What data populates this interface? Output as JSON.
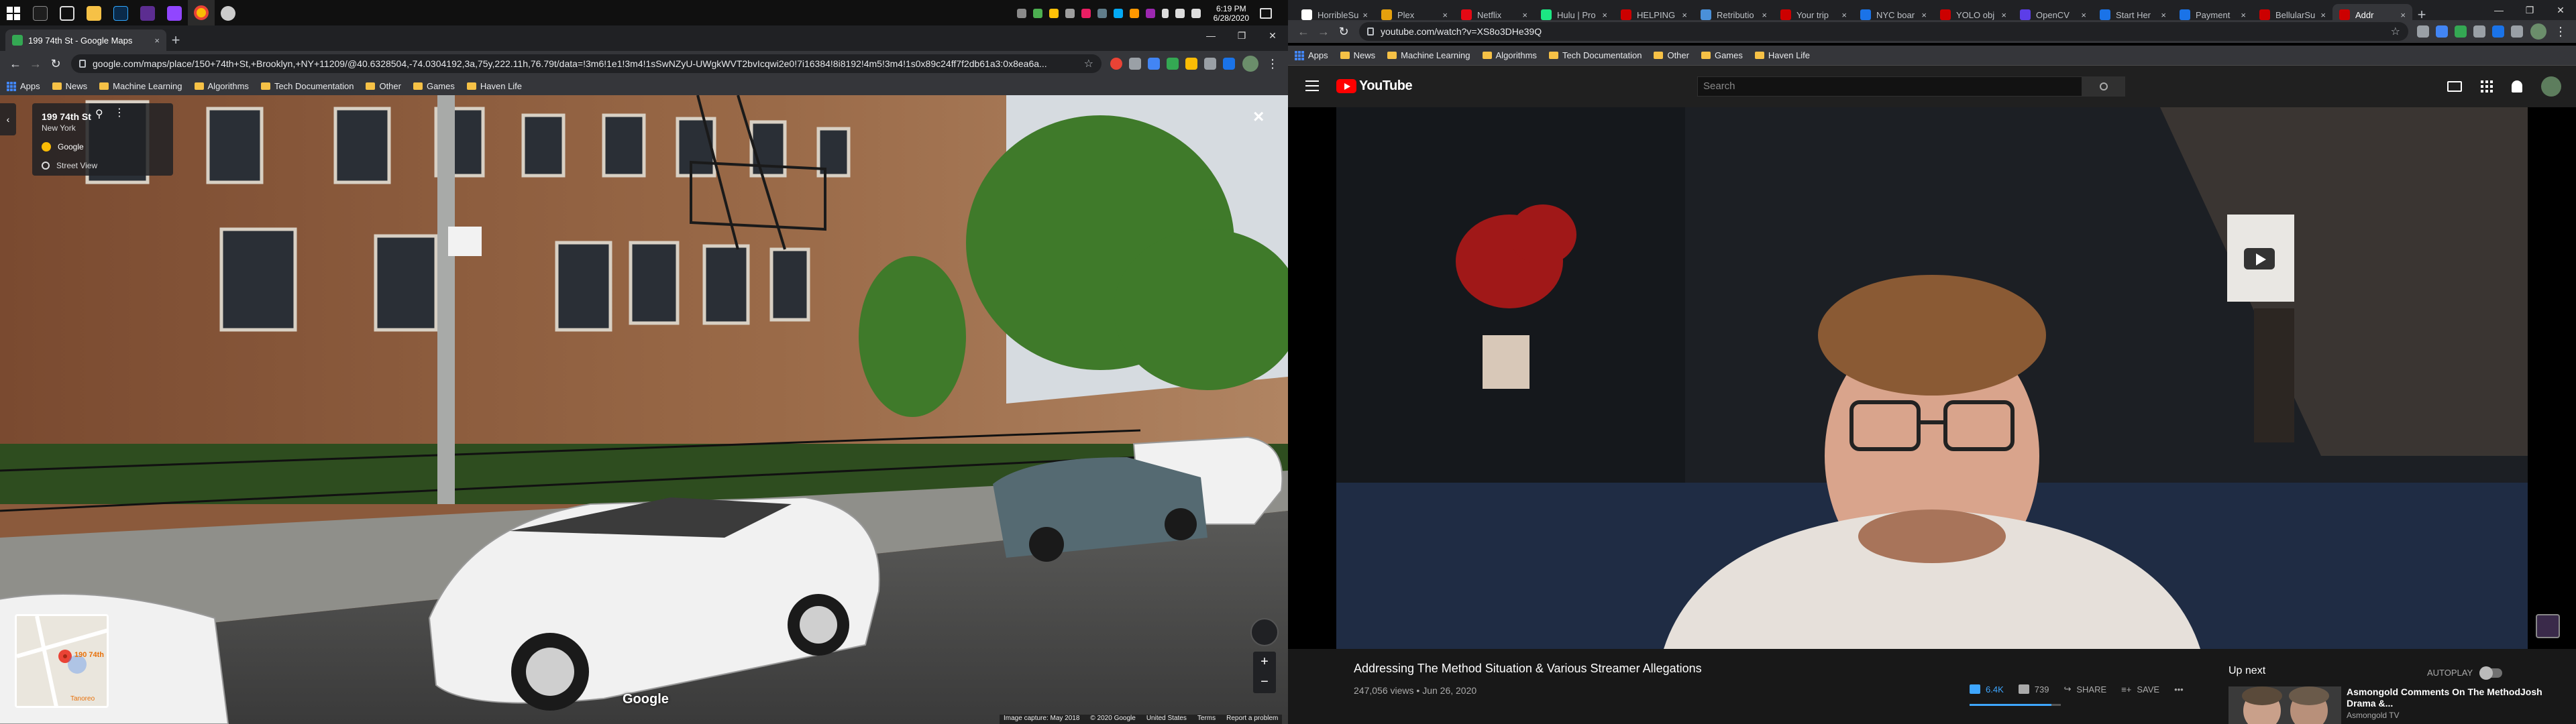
{
  "taskbar": {
    "time": "6:19 PM",
    "date": "6/28/2020"
  },
  "left_window": {
    "tab": {
      "title": "199 74th St - Google Maps",
      "close": "×"
    },
    "new_tab": "+",
    "url": "google.com/maps/place/150+74th+St,+Brooklyn,+NY+11209/@40.6328504,-74.0304192,3a,75y,222.11h,76.79t/data=!3m6!1e1!3m4!1sSwNZyU-UWgkWVT2bvIcqwi2e0!7i16384!8i8192!4m5!3m4!1s0x89c24ff7f2db61a3:0x8ea6a...",
    "bookmarks": [
      "Apps",
      "News",
      "Machine Learning",
      "Algorithms",
      "Tech Documentation",
      "Other",
      "Games",
      "Haven Life"
    ],
    "streetview": {
      "title": "199 74th St",
      "subtitle": "New York",
      "provider": "Google",
      "mode": "Street View",
      "close": "×",
      "collapse": "‹",
      "zoom_in": "+",
      "zoom_out": "−",
      "logo": "Google",
      "minimap_label": "190 74th",
      "minimap_label_2": "Tanoreo",
      "footer": [
        "Image capture: May 2018",
        "© 2020 Google",
        "United States",
        "Terms",
        "Report a problem"
      ]
    }
  },
  "right_window": {
    "tabs": [
      "HorribleSu",
      "Plex",
      "Netflix",
      "Hulu | Pro",
      "HELPING",
      "Retributio",
      "Your trip",
      "NYC boar",
      "YOLO obj",
      "OpenCV",
      "Start Her",
      "Payment",
      "BellularSu",
      "Addr"
    ],
    "tab_favicon_colors": [
      "#ffffff",
      "#e5a00d",
      "#e50914",
      "#1ce783",
      "#cc0000",
      "#4a90d9",
      "#cc0000",
      "#1a73e8",
      "#cc0000",
      "#5c3ee8",
      "#1a73e8",
      "#1a73e8",
      "#cc0000",
      "#cc0000"
    ],
    "new_tab": "+",
    "url": "youtube.com/watch?v=XS8o3DHe39Q",
    "bookmarks": [
      "Apps",
      "News",
      "Machine Learning",
      "Algorithms",
      "Tech Documentation",
      "Other",
      "Games",
      "Haven Life"
    ],
    "youtube": {
      "logo_text": "YouTube",
      "search_placeholder": "Search",
      "video_title": "Addressing The Method Situation & Various Streamer Allegations",
      "views": "247,056 views",
      "date": "Jun 26, 2020",
      "meta_sep": " • ",
      "likes": "6.4K",
      "dislikes": "739",
      "like_ratio": 0.9,
      "share": "SHARE",
      "save": "SAVE",
      "more": "•••",
      "up_next": "Up next",
      "autoplay": "AUTOPLAY",
      "next_video": {
        "title": "Asmongold Comments On The MethodJosh Drama &...",
        "channel": "Asmongold TV"
      }
    }
  },
  "colors": {
    "youtube_red": "#ff0000",
    "like_blue": "#3ea6ff",
    "chrome_dark": "#35363a"
  }
}
